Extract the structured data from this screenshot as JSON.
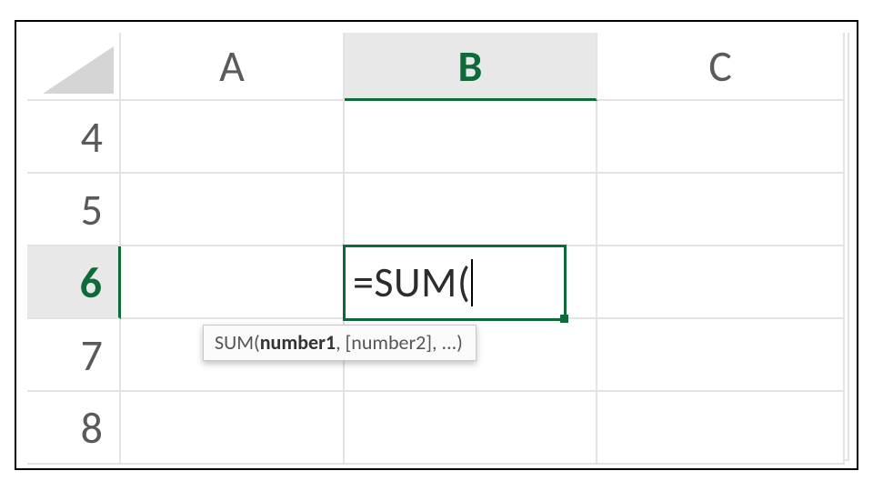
{
  "columns": [
    "A",
    "B",
    "C"
  ],
  "rows": [
    "4",
    "5",
    "6",
    "7",
    "8"
  ],
  "activeColumn": "B",
  "activeRow": "6",
  "activeCell": {
    "address": "B6",
    "formulaText": "=SUM("
  },
  "tooltip": {
    "fn": "SUM(",
    "argCurrent": "number1",
    "rest": ", [number2], ...)"
  },
  "colors": {
    "accent": "#0f6a3a",
    "gridline": "#e3e3e3",
    "headerSelectedBg": "#e8e8e8"
  }
}
